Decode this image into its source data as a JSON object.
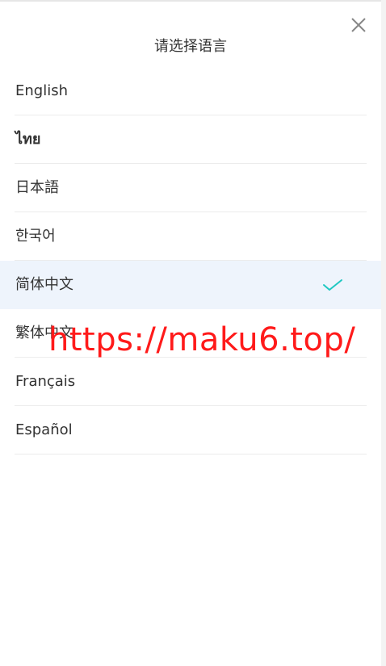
{
  "dialog": {
    "title": "请选择语言",
    "close_icon": "close-icon"
  },
  "languages": [
    {
      "label": "English",
      "selected": false
    },
    {
      "label": "ไทย",
      "selected": false
    },
    {
      "label": "日本語",
      "selected": false
    },
    {
      "label": "한국어",
      "selected": false
    },
    {
      "label": "简体中文",
      "selected": true
    },
    {
      "label": "繁体中文",
      "selected": false
    },
    {
      "label": "Français",
      "selected": false
    },
    {
      "label": "Español",
      "selected": false
    }
  ],
  "selected_icon": "checkmark-icon",
  "watermark": "https://maku6.top/",
  "colors": {
    "accent": "#1fc8c2",
    "selected_background": "#eef4fc",
    "watermark": "#ff1a1a"
  }
}
